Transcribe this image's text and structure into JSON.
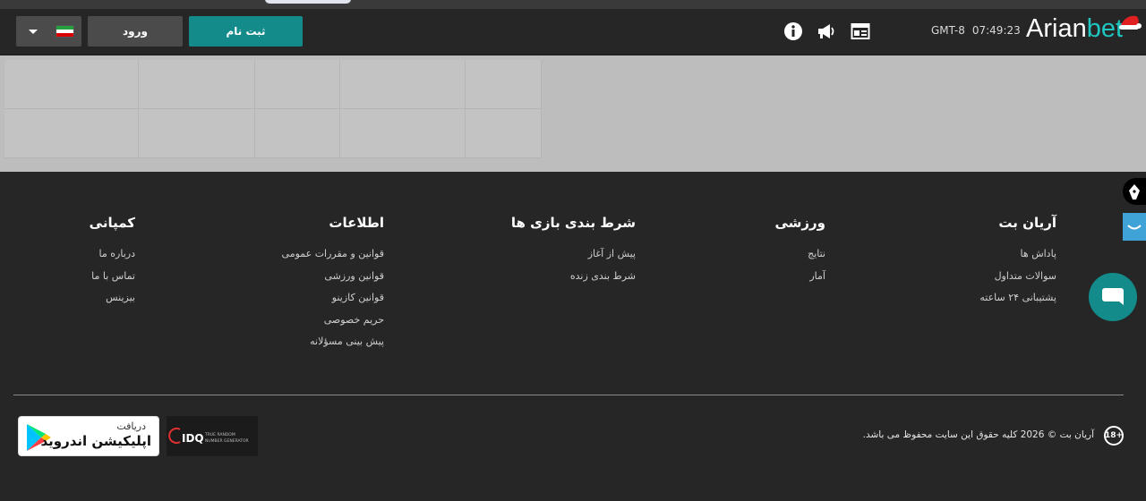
{
  "header": {
    "language": "Persian",
    "login_label": "ورود",
    "register_label": "ثبت نام",
    "icons": [
      "info-icon",
      "megaphone-icon",
      "news-icon"
    ],
    "timezone": "GMT-8",
    "time": "07:49:23",
    "logo": {
      "part1": "Arian",
      "part2": "bet"
    }
  },
  "colors": {
    "accent": "#138b8a",
    "brand_teal": "#1fc6c1",
    "background": "#262626"
  },
  "footer": {
    "columns": [
      {
        "title": "آریان بت",
        "links": [
          "پاداش ها",
          "سوالات متداول",
          "پشتیبانی ۲۴ ساعته"
        ]
      },
      {
        "title": "ورزشی",
        "links": [
          "نتایج",
          "آمار"
        ]
      },
      {
        "title": "شرط بندی بازی ها",
        "links": [
          "پیش از آغاز",
          "شرط بندی زنده"
        ]
      },
      {
        "title": "اطلاعات",
        "links": [
          "قوانین و مقررات عمومی",
          "قوانین ورزشی",
          "قوانین کازینو",
          "حریم خصوصی",
          "پیش بینی مسؤلانه"
        ]
      },
      {
        "title": "کمپانی",
        "links": [
          "درباره ما",
          "تماس با ما",
          "بیزینس"
        ]
      }
    ],
    "app_badge": {
      "line1": "دریافت",
      "line2": "اپلیکیشن اندروید"
    },
    "idq": {
      "brand": "IDQ",
      "sub1": "TRUE RANDOM",
      "sub2": "NUMBER GENERATOR"
    },
    "age_badge": "18+",
    "copyright": "آریان بت © 2026 کلیه حقوق این سایت محفوظ می باشد."
  }
}
